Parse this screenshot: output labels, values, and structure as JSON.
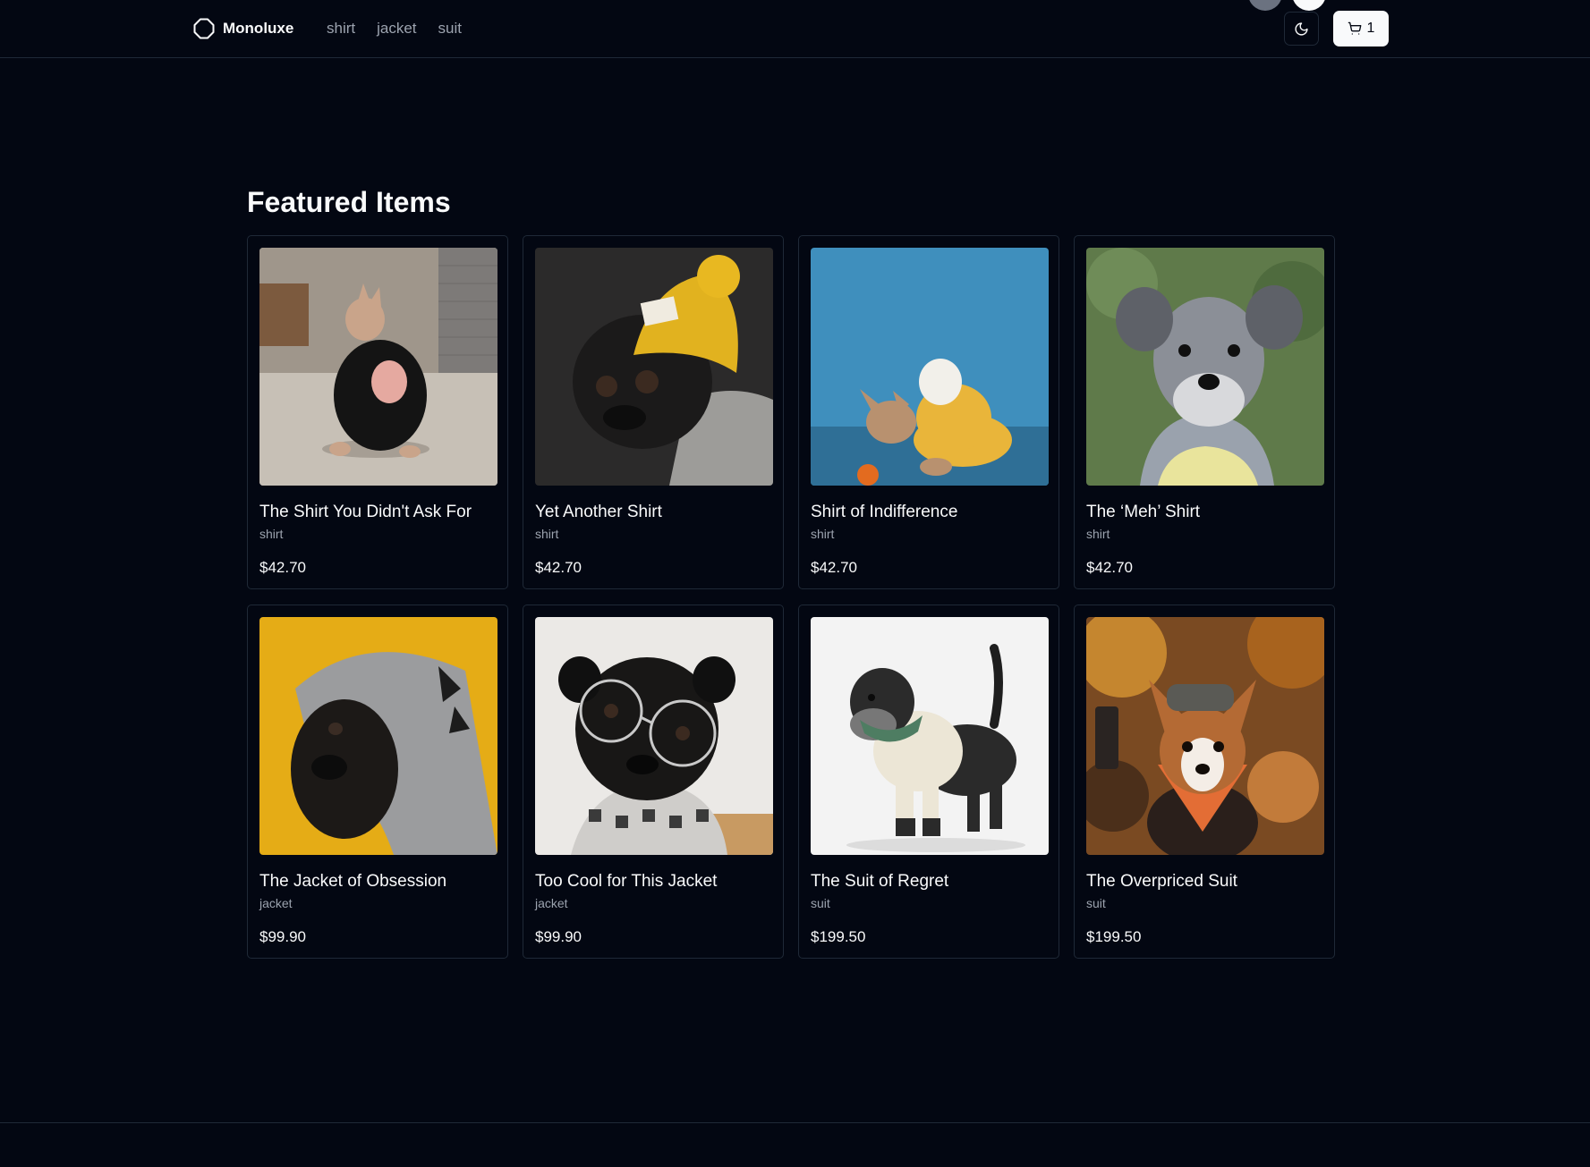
{
  "header": {
    "brand": "Monoluxe",
    "nav": [
      {
        "label": "shirt"
      },
      {
        "label": "jacket"
      },
      {
        "label": "suit"
      }
    ],
    "cart_count": "1",
    "theme_icon": "moon-icon",
    "cart_icon": "shopping-cart-icon"
  },
  "main": {
    "title": "Featured Items",
    "products": [
      {
        "name": "The Shirt You Didn't Ask For",
        "category": "shirt",
        "price": "$42.70",
        "image": "french-bulldog-black-sweater"
      },
      {
        "name": "Yet Another Shirt",
        "category": "shirt",
        "price": "$42.70",
        "image": "pug-yellow-beanie"
      },
      {
        "name": "Shirt of Indifference",
        "category": "shirt",
        "price": "$42.70",
        "image": "french-bulldog-yellow-hoodie"
      },
      {
        "name": "The ‘Meh’ Shirt",
        "category": "shirt",
        "price": "$42.70",
        "image": "schnauzer-yellow-shirt"
      },
      {
        "name": "The Jacket of Obsession",
        "category": "jacket",
        "price": "$99.90",
        "image": "pug-gray-hoodie"
      },
      {
        "name": "Too Cool for This Jacket",
        "category": "jacket",
        "price": "$99.90",
        "image": "pug-round-glasses"
      },
      {
        "name": "The Suit of Regret",
        "category": "suit",
        "price": "$199.50",
        "image": "schnauzer-cream-sweater"
      },
      {
        "name": "The Overpriced Suit",
        "category": "suit",
        "price": "$199.50",
        "image": "corgi-orange-bandana"
      }
    ]
  },
  "colors": {
    "background": "#030712",
    "border": "#1f2937",
    "text": "#f9fafb",
    "muted_text": "#9ca3af"
  }
}
